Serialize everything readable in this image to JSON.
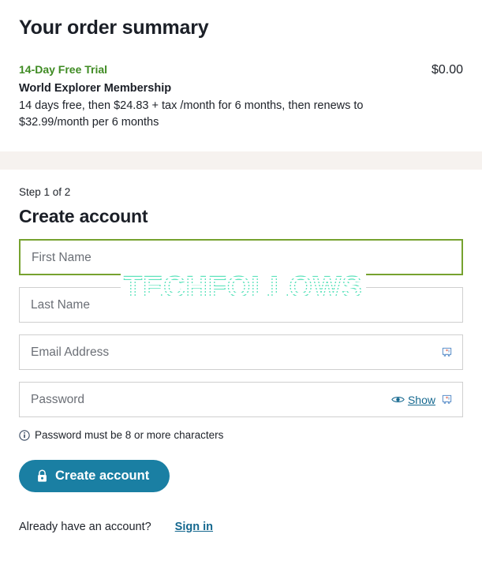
{
  "order_summary": {
    "title": "Your order summary",
    "trial_label": "14-Day Free Trial",
    "price": "$0.00",
    "plan_name": "World Explorer Membership",
    "plan_description": "14 days free, then $24.83 + tax /month for 6 months, then renews to $32.99/month per 6 months"
  },
  "form": {
    "step_label": "Step 1 of 2",
    "title": "Create account",
    "fields": [
      {
        "name": "first-name",
        "placeholder": "First Name",
        "value": "",
        "focused": true
      },
      {
        "name": "last-name",
        "placeholder": "Last Name",
        "value": "",
        "focused": false
      },
      {
        "name": "email",
        "placeholder": "Email Address",
        "value": "",
        "focused": false
      },
      {
        "name": "password",
        "placeholder": "Password",
        "value": "",
        "focused": false
      }
    ],
    "show_password_label": "Show",
    "password_hint": "Password must be 8 or more characters",
    "submit_label": "Create account",
    "signin_prompt": "Already have an account?",
    "signin_link": "Sign in"
  },
  "watermark": {
    "text": "TECHFOLLOWS"
  },
  "icons": {
    "eye": "eye-icon",
    "lock": "lock-icon",
    "info": "info-circle-icon",
    "password_manager": "password-manager-icon"
  },
  "colors": {
    "trial_green": "#3f8b23",
    "button_teal": "#1a7fa3",
    "link_blue": "#15688f",
    "focus_border": "#76a22f",
    "band_beige": "#f6f2ef",
    "watermark_mint": "#5fe3bd"
  }
}
